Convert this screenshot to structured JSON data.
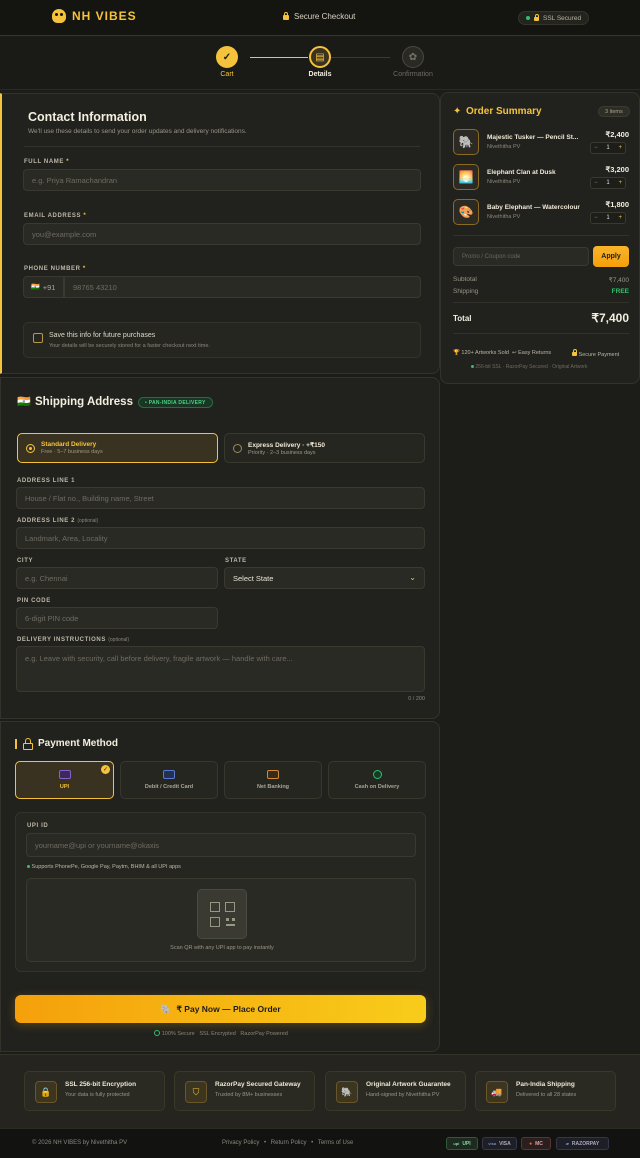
{
  "header": {
    "brand": "NH VIBES",
    "secure_checkout": "Secure Checkout",
    "ssl_badge": "SSL Secured"
  },
  "steps": [
    {
      "label": "Cart",
      "state": "done"
    },
    {
      "label": "Details",
      "state": "active"
    },
    {
      "label": "Confirmation",
      "state": "pending"
    }
  ],
  "contact": {
    "title": "Contact Information",
    "subtitle": "We'll use these details to send your order updates and delivery notifications.",
    "full_name_label": "FULL NAME",
    "full_name_placeholder": "e.g. Priya Ramachandran",
    "email_label": "EMAIL ADDRESS",
    "email_placeholder": "you@example.com",
    "phone_label": "PHONE NUMBER",
    "phone_code": "+91",
    "phone_placeholder": "98765 43210",
    "save_label": "Save this info for future purchases",
    "save_sub": "Your details will be securely stored for a faster checkout next time.",
    "required_mark": "*"
  },
  "shipping": {
    "title": "Shipping Address",
    "badge": "• PAN-INDIA DELIVERY",
    "options": [
      {
        "title": "Standard Delivery",
        "sub": "Free · 5–7 business days",
        "selected": true
      },
      {
        "title": "Express Delivery · +₹150",
        "sub": "Priority · 2–3 business days",
        "selected": false
      }
    ],
    "addr1_label": "ADDRESS LINE 1",
    "addr1_placeholder": "House / Flat no., Building name, Street",
    "addr2_label": "ADDRESS LINE 2",
    "addr2_optional": "(optional)",
    "addr2_placeholder": "Landmark, Area, Locality",
    "city_label": "CITY",
    "city_placeholder": "e.g. Chennai",
    "state_label": "STATE",
    "state_value": "Select State",
    "pin_label": "PIN CODE",
    "pin_placeholder": "6-digit PIN code",
    "instr_label": "DELIVERY INSTRUCTIONS",
    "instr_optional": "(optional)",
    "instr_placeholder": "e.g. Leave with security, call before delivery, fragile artwork — handle with care...",
    "instr_count": "0 / 200"
  },
  "payment": {
    "title": "Payment Method",
    "tabs": [
      {
        "label": "UPI",
        "selected": true
      },
      {
        "label": "Debit / Credit Card",
        "selected": false
      },
      {
        "label": "Net Banking",
        "selected": false
      },
      {
        "label": "Cash on Delivery",
        "selected": false
      }
    ],
    "upi_label": "UPI ID",
    "upi_placeholder": "yourname@upi or yourname@okaxis",
    "upi_support": "Supports PhonePe, Google Pay, Paytm, BHIM & all UPI apps",
    "qr_caption": "Scan QR with any UPI app to pay instantly",
    "pay_button": "₹ Pay Now — Place Order",
    "footnotes": [
      "100% Secure",
      "SSL Encrypted",
      "RazorPay Powered"
    ]
  },
  "summary": {
    "title": "Order Summary",
    "count": "3 items",
    "items": [
      {
        "name": "Majestic Tusker — Pencil St...",
        "artist": "Nivethitha PV",
        "price": "₹2,400",
        "qty": "1"
      },
      {
        "name": "Elephant Clan at Dusk",
        "artist": "Nivethitha PV",
        "price": "₹3,200",
        "qty": "1"
      },
      {
        "name": "Baby Elephant — Watercolour",
        "artist": "Nivethitha PV",
        "price": "₹1,800",
        "qty": "1"
      }
    ],
    "promo_placeholder": "Promo / Coupon code",
    "apply": "Apply",
    "subtotal_label": "Subtotal",
    "subtotal": "₹7,400",
    "shipping_label": "Shipping",
    "shipping": "FREE",
    "total_label": "Total",
    "total": "₹7,400",
    "trust1": "120+ Artworks Sold",
    "trust2": "Easy Returns",
    "trust3": "Secure Payment",
    "badges": "256-bit SSL · RazorPay Secured · Original Artwork"
  },
  "trust": [
    {
      "title": "SSL 256-bit Encryption",
      "sub": "Your data is fully protected"
    },
    {
      "title": "RazorPay Secured Gateway",
      "sub": "Trusted by 8M+ businesses"
    },
    {
      "title": "Original Artwork Guarantee",
      "sub": "Hand-signed by Nivethitha PV"
    },
    {
      "title": "Pan-India Shipping",
      "sub": "Delivered to all 28 states"
    }
  ],
  "footer": {
    "copyright": "© 2026 NH VIBES by Nivethitha PV",
    "links": [
      "Privacy Policy",
      "Return Policy",
      "Terms of Use"
    ],
    "sep": "•",
    "pay_badges": [
      "UPI",
      "VISA",
      "MC",
      "RAZORPAY"
    ]
  },
  "colors": {
    "accent": "#f5c33b",
    "accent_dark": "#f59e0b",
    "bg": "#1c1c19",
    "card": "#21211d",
    "success": "#2fc26a"
  }
}
